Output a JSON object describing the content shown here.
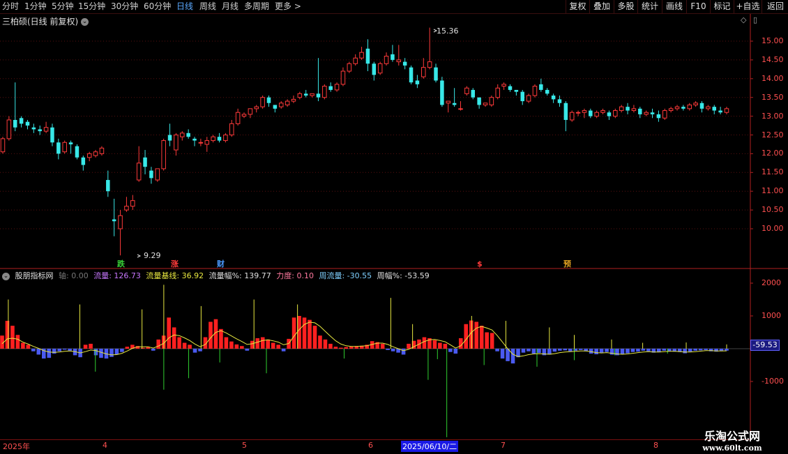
{
  "toolbar": {
    "tabs": [
      "分时",
      "1分钟",
      "5分钟",
      "15分钟",
      "30分钟",
      "60分钟",
      "日线",
      "周线",
      "月线",
      "多周期",
      "更多 >"
    ],
    "active_tab": "日线",
    "buttons": [
      "复权",
      "叠加",
      "多股",
      "统计",
      "画线",
      "F10",
      "标记",
      "+自选",
      "返回"
    ]
  },
  "chart_title": "三柏硕(日线 前复权)",
  "price_axis": [
    "15.00",
    "14.50",
    "14.00",
    "13.50",
    "13.00",
    "12.50",
    "12.00",
    "11.50",
    "11.00",
    "10.50",
    "10.00"
  ],
  "high_label": "15.36",
  "low_label": "9.29",
  "markers": [
    {
      "text": "跌",
      "color": "#38d038"
    },
    {
      "text": "涨",
      "color": "#ff3a3a"
    },
    {
      "text": "财",
      "color": "#4a9aff"
    },
    {
      "text": "$",
      "color": "#ff3a3a"
    },
    {
      "text": "预",
      "color": "#e0a020"
    }
  ],
  "indicator": {
    "name": "股朋指标网",
    "axis_label": "轴: 0.00",
    "flow_label": "流量: 126.73",
    "baseline_label": "流量基线: 36.92",
    "flow_pct_label": "流量幅%: 139.77",
    "strength_label": "力度: 0.10",
    "week_flow_label": "周流量: -30.55",
    "week_pct_label": "周幅%: -53.59"
  },
  "indicator_axis": [
    "2000",
    "1000",
    "-1000"
  ],
  "indicator_value_tag": "-59.53",
  "date_axis": [
    "2025年",
    "4",
    "5",
    "6",
    "7",
    "8"
  ],
  "date_cursor": "2025/06/10/二",
  "watermark": {
    "title": "乐淘公式网",
    "url": "www.60lt.com"
  },
  "chart_data": {
    "type": "candlestick",
    "ylim": [
      9.0,
      15.4
    ],
    "candles": [
      [
        12.05,
        12.4,
        12.0,
        12.45
      ],
      [
        12.4,
        12.9,
        12.35,
        13.0
      ],
      [
        12.9,
        12.7,
        12.6,
        13.9
      ],
      [
        12.95,
        12.8,
        12.7,
        13.0
      ],
      [
        12.85,
        12.75,
        12.65,
        12.9
      ],
      [
        12.7,
        12.65,
        12.55,
        12.8
      ],
      [
        12.65,
        12.6,
        12.5,
        12.75
      ],
      [
        12.6,
        12.7,
        12.55,
        12.85
      ],
      [
        12.7,
        12.3,
        12.2,
        12.8
      ],
      [
        12.3,
        12.0,
        11.85,
        12.4
      ],
      [
        12.05,
        12.3,
        12.0,
        12.35
      ],
      [
        12.3,
        12.25,
        12.0,
        12.35
      ],
      [
        12.2,
        11.9,
        11.85,
        12.25
      ],
      [
        11.9,
        11.7,
        11.55,
        11.95
      ],
      [
        11.9,
        12.0,
        11.8,
        12.05
      ],
      [
        11.95,
        12.05,
        11.9,
        12.1
      ],
      [
        12.0,
        12.15,
        11.95,
        12.2
      ],
      [
        11.3,
        11.0,
        10.85,
        11.55
      ],
      [
        10.25,
        10.2,
        9.8,
        10.8
      ],
      [
        10.0,
        10.35,
        9.29,
        10.5
      ],
      [
        10.5,
        10.6,
        10.45,
        10.85
      ],
      [
        10.6,
        10.75,
        10.5,
        10.9
      ],
      [
        11.3,
        11.75,
        11.25,
        12.2
      ],
      [
        11.9,
        11.65,
        11.45,
        12.1
      ],
      [
        11.55,
        11.35,
        11.2,
        11.65
      ],
      [
        11.3,
        11.6,
        11.25,
        11.6
      ],
      [
        11.6,
        12.35,
        11.55,
        12.4
      ],
      [
        12.5,
        12.35,
        12.2,
        12.8
      ],
      [
        12.1,
        12.5,
        11.95,
        12.55
      ],
      [
        12.45,
        12.55,
        12.35,
        12.6
      ],
      [
        12.55,
        12.45,
        12.4,
        12.65
      ],
      [
        12.4,
        12.35,
        12.2,
        12.45
      ],
      [
        12.3,
        12.3,
        12.2,
        12.4
      ],
      [
        12.25,
        12.35,
        12.05,
        12.45
      ],
      [
        12.35,
        12.45,
        12.3,
        12.5
      ],
      [
        12.45,
        12.35,
        12.3,
        12.55
      ],
      [
        12.35,
        12.5,
        12.3,
        12.55
      ],
      [
        12.5,
        12.8,
        12.45,
        12.9
      ],
      [
        12.8,
        13.1,
        12.75,
        13.2
      ],
      [
        13.0,
        13.05,
        12.95,
        13.1
      ],
      [
        13.05,
        13.2,
        12.95,
        13.2
      ],
      [
        13.2,
        13.25,
        13.1,
        13.3
      ],
      [
        13.25,
        13.5,
        13.2,
        13.55
      ],
      [
        13.5,
        13.35,
        13.25,
        13.55
      ],
      [
        13.3,
        13.2,
        13.1,
        13.3
      ],
      [
        13.25,
        13.35,
        13.2,
        13.4
      ],
      [
        13.3,
        13.4,
        13.25,
        13.45
      ],
      [
        13.4,
        13.45,
        13.35,
        13.55
      ],
      [
        13.5,
        13.6,
        13.45,
        13.65
      ],
      [
        13.6,
        13.55,
        13.5,
        13.7
      ],
      [
        13.55,
        13.6,
        13.5,
        13.6
      ],
      [
        13.6,
        13.5,
        13.4,
        14.55
      ],
      [
        13.5,
        13.8,
        13.45,
        13.85
      ],
      [
        13.8,
        13.7,
        13.65,
        13.9
      ],
      [
        13.7,
        13.85,
        13.65,
        13.9
      ],
      [
        13.85,
        14.2,
        13.8,
        14.3
      ],
      [
        14.2,
        14.4,
        14.15,
        14.45
      ],
      [
        14.4,
        14.55,
        14.35,
        14.65
      ],
      [
        14.55,
        14.7,
        14.5,
        14.85
      ],
      [
        14.8,
        14.4,
        14.2,
        15.05
      ],
      [
        14.4,
        14.1,
        13.95,
        14.45
      ],
      [
        14.15,
        14.4,
        14.1,
        14.45
      ],
      [
        14.4,
        14.6,
        14.35,
        14.7
      ],
      [
        14.65,
        14.5,
        14.45,
        14.9
      ],
      [
        14.45,
        14.5,
        14.35,
        14.9
      ],
      [
        14.45,
        14.35,
        14.25,
        14.55
      ],
      [
        14.3,
        13.9,
        13.85,
        14.35
      ],
      [
        13.95,
        13.85,
        13.75,
        14.1
      ],
      [
        14.05,
        14.3,
        14.0,
        14.55
      ],
      [
        14.3,
        14.45,
        14.25,
        15.36
      ],
      [
        14.3,
        13.95,
        13.9,
        14.4
      ],
      [
        13.95,
        13.3,
        13.25,
        14.05
      ],
      [
        13.35,
        13.4,
        13.1,
        13.4
      ],
      [
        13.35,
        13.3,
        13.25,
        13.75
      ],
      [
        13.2,
        13.2,
        13.15,
        13.4
      ],
      [
        13.6,
        13.75,
        13.55,
        13.8
      ],
      [
        13.7,
        13.5,
        13.45,
        13.75
      ],
      [
        13.5,
        13.3,
        13.2,
        13.5
      ],
      [
        13.3,
        13.35,
        13.25,
        13.35
      ],
      [
        13.3,
        13.5,
        13.25,
        13.55
      ],
      [
        13.5,
        13.75,
        13.45,
        13.85
      ],
      [
        13.8,
        13.85,
        13.7,
        13.9
      ],
      [
        13.8,
        13.7,
        13.65,
        13.85
      ],
      [
        13.7,
        13.65,
        13.55,
        13.7
      ],
      [
        13.65,
        13.4,
        13.3,
        13.7
      ],
      [
        13.4,
        13.55,
        13.35,
        13.6
      ],
      [
        13.55,
        13.8,
        13.5,
        13.85
      ],
      [
        13.85,
        13.7,
        13.65,
        14.0
      ],
      [
        13.7,
        13.6,
        13.55,
        13.75
      ],
      [
        13.55,
        13.45,
        13.35,
        13.6
      ],
      [
        13.45,
        13.35,
        13.25,
        13.55
      ],
      [
        13.35,
        12.9,
        12.6,
        13.4
      ],
      [
        12.9,
        13.1,
        12.85,
        13.15
      ],
      [
        13.1,
        13.1,
        13.0,
        13.15
      ],
      [
        13.1,
        13.15,
        12.95,
        13.2
      ],
      [
        13.15,
        13.0,
        12.95,
        13.2
      ],
      [
        13.0,
        13.1,
        12.95,
        13.15
      ],
      [
        13.1,
        13.15,
        13.05,
        13.2
      ],
      [
        13.1,
        13.0,
        12.9,
        13.15
      ],
      [
        13.0,
        13.15,
        12.95,
        13.2
      ],
      [
        13.15,
        13.25,
        13.1,
        13.3
      ],
      [
        13.25,
        13.15,
        13.05,
        13.35
      ],
      [
        13.15,
        13.2,
        13.1,
        13.3
      ],
      [
        13.2,
        13.05,
        12.95,
        13.25
      ],
      [
        13.05,
        13.1,
        13.0,
        13.15
      ],
      [
        13.1,
        13.05,
        12.95,
        13.2
      ],
      [
        13.05,
        12.95,
        12.85,
        13.15
      ],
      [
        12.95,
        13.15,
        12.9,
        13.2
      ],
      [
        13.15,
        13.2,
        13.1,
        13.25
      ],
      [
        13.2,
        13.25,
        13.15,
        13.3
      ],
      [
        13.25,
        13.2,
        13.15,
        13.3
      ],
      [
        13.2,
        13.3,
        13.15,
        13.35
      ],
      [
        13.3,
        13.35,
        13.25,
        13.4
      ],
      [
        13.35,
        13.2,
        13.1,
        13.4
      ],
      [
        13.2,
        13.25,
        13.15,
        13.3
      ],
      [
        13.25,
        13.15,
        13.05,
        13.3
      ],
      [
        13.15,
        13.1,
        13.05,
        13.25
      ],
      [
        13.1,
        13.2,
        13.05,
        13.25
      ]
    ],
    "flow": [
      400,
      850,
      700,
      420,
      180,
      120,
      -80,
      -180,
      -300,
      -280,
      -150,
      -80,
      -30,
      -60,
      -200,
      -260,
      120,
      150,
      -200,
      -280,
      -300,
      -250,
      -180,
      -100,
      60,
      120,
      80,
      30,
      50,
      -60,
      280,
      400,
      950,
      650,
      350,
      180,
      120,
      -120,
      -80,
      350,
      820,
      900,
      600,
      350,
      220,
      130,
      80,
      -60,
      240,
      320,
      350,
      280,
      180,
      120,
      -80,
      300,
      950,
      1000,
      950,
      880,
      700,
      400,
      280,
      150,
      60,
      30,
      50,
      60,
      80,
      90,
      120,
      230,
      200,
      150,
      -40,
      -80,
      -120,
      -180,
      150,
      240,
      280,
      350,
      320,
      260,
      180,
      150,
      -100,
      -150,
      320,
      750,
      860,
      820,
      700,
      500,
      480,
      -80,
      -300,
      -380,
      -450,
      -260,
      -120,
      -80,
      -150,
      -130,
      -200,
      -180,
      -90,
      -60,
      -50,
      -80,
      -60,
      -40,
      -80,
      -150,
      -170,
      -120,
      -100,
      -180,
      -200,
      -160,
      -140,
      -100,
      -90,
      -60,
      -80,
      -120,
      -110,
      -60,
      -80,
      -90,
      -100,
      -140,
      -90,
      -60,
      -50,
      -40,
      -80,
      -90,
      -70,
      -60
    ],
    "baseline": [
      150,
      300,
      320,
      290,
      200,
      140,
      70,
      10,
      -60,
      -100,
      -110,
      -100,
      -80,
      -70,
      -90,
      -130,
      -90,
      -40,
      -60,
      -110,
      -160,
      -190,
      -180,
      -140,
      -70,
      10,
      60,
      60,
      60,
      20,
      80,
      160,
      330,
      420,
      400,
      330,
      250,
      140,
      60,
      130,
      330,
      500,
      550,
      480,
      390,
      300,
      220,
      130,
      150,
      200,
      250,
      270,
      240,
      200,
      120,
      160,
      380,
      580,
      740,
      810,
      790,
      680,
      530,
      380,
      240,
      140,
      90,
      70,
      70,
      80,
      90,
      130,
      170,
      170,
      130,
      60,
      0,
      -60,
      -20,
      60,
      140,
      220,
      270,
      280,
      250,
      210,
      120,
      20,
      90,
      280,
      490,
      630,
      680,
      630,
      570,
      400,
      200,
      0,
      -170,
      -240,
      -220,
      -180,
      -160,
      -150,
      -160,
      -170,
      -150,
      -120,
      -100,
      -90,
      -80,
      -70,
      -70,
      -90,
      -120,
      -130,
      -120,
      -140,
      -160,
      -170,
      -160,
      -140,
      -120,
      -100,
      -90,
      -100,
      -100,
      -90,
      -80,
      -80,
      -90,
      -100,
      -100,
      -90,
      -75,
      -60,
      -60,
      -70,
      -70,
      -65
    ],
    "spikes": [
      [
        2,
        1500
      ],
      [
        25,
        1350
      ],
      [
        45,
        1200
      ],
      [
        52,
        1950
      ],
      [
        64,
        1300
      ],
      [
        81,
        1500
      ],
      [
        95,
        1350
      ],
      [
        125,
        1550
      ],
      [
        132,
        750
      ],
      [
        151,
        1000
      ],
      [
        162,
        850
      ],
      [
        176,
        650
      ],
      [
        184,
        420
      ],
      [
        196,
        280
      ],
      [
        206,
        180
      ],
      [
        220,
        190
      ],
      [
        233,
        130
      ],
      [
        30,
        -700
      ],
      [
        52,
        -1250
      ],
      [
        60,
        -900
      ],
      [
        70,
        -420
      ],
      [
        85,
        -750
      ],
      [
        110,
        -300
      ],
      [
        137,
        -950
      ],
      [
        140,
        -320
      ],
      [
        143,
        -2700
      ],
      [
        155,
        -500
      ],
      [
        172,
        -550
      ],
      [
        184,
        -350
      ],
      [
        197,
        -200
      ],
      [
        214,
        -150
      ]
    ]
  }
}
